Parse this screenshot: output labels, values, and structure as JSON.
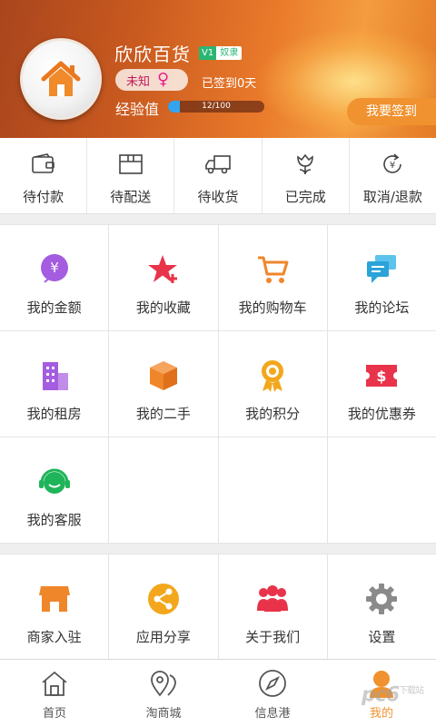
{
  "profile": {
    "shop_name": "欣欣百货",
    "level": "V1",
    "level_name": "奴隶",
    "gender_label": "未知",
    "gender_symbol": "♀",
    "signed_days": "已签到0天",
    "exp_label": "经验值",
    "exp_text": "12/100",
    "exp_progress": 0.12,
    "signin_button": "我要签到"
  },
  "orders": [
    {
      "label": "待付款",
      "icon": "wallet-icon"
    },
    {
      "label": "待配送",
      "icon": "package-icon"
    },
    {
      "label": "待收货",
      "icon": "truck-icon"
    },
    {
      "label": "已完成",
      "icon": "tulip-icon"
    },
    {
      "label": "取消/退款",
      "icon": "refund-icon"
    }
  ],
  "features": [
    {
      "label": "我的金额",
      "icon": "money-icon",
      "color": "#a45de0"
    },
    {
      "label": "我的收藏",
      "icon": "star-icon",
      "color": "#e8334a"
    },
    {
      "label": "我的购物车",
      "icon": "cart-icon",
      "color": "#f0862a"
    },
    {
      "label": "我的论坛",
      "icon": "chat-icon",
      "color": "#2aa3d8"
    },
    {
      "label": "我的租房",
      "icon": "building-icon",
      "color": "#a45de0"
    },
    {
      "label": "我的二手",
      "icon": "box-icon",
      "color": "#f0862a"
    },
    {
      "label": "我的积分",
      "icon": "medal-icon",
      "color": "#f2a71c"
    },
    {
      "label": "我的优惠券",
      "icon": "coupon-icon",
      "color": "#e8334a"
    },
    {
      "label": "我的客服",
      "icon": "headset-icon",
      "color": "#1fb45a"
    }
  ],
  "misc": [
    {
      "label": "商家入驻",
      "icon": "store-icon",
      "color": "#f0862a"
    },
    {
      "label": "应用分享",
      "icon": "share-icon",
      "color": "#f2a71c"
    },
    {
      "label": "关于我们",
      "icon": "people-icon",
      "color": "#e8334a"
    },
    {
      "label": "设置",
      "icon": "gear-icon",
      "color": "#888888"
    }
  ],
  "tabs": [
    {
      "label": "首页",
      "icon": "home-icon"
    },
    {
      "label": "淘商城",
      "icon": "location-icon"
    },
    {
      "label": "信息港",
      "icon": "compass-icon"
    },
    {
      "label": "我的",
      "icon": "user-icon",
      "active": true
    }
  ],
  "watermark": {
    "text": "pc6",
    "suffix": "下载站"
  },
  "colors": {
    "accent": "#f0922f",
    "header": "#e9792a"
  }
}
